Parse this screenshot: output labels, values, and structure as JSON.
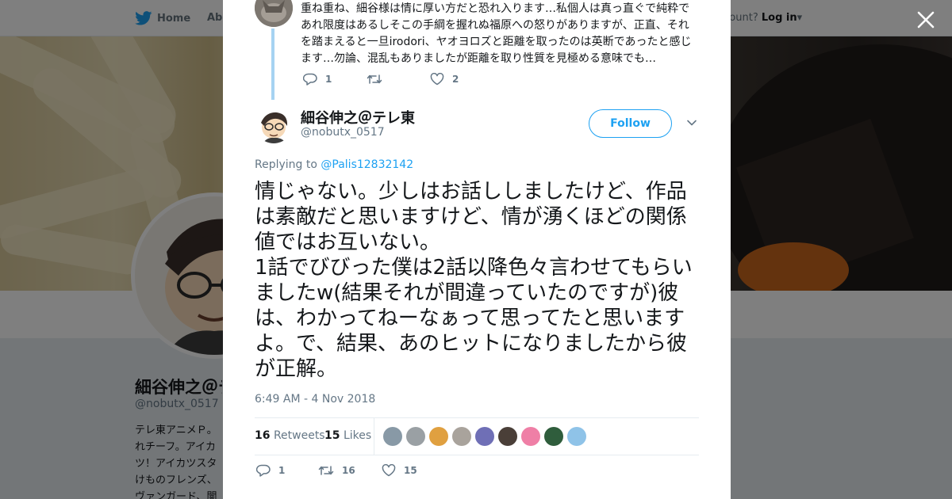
{
  "background": {
    "nav": {
      "home_label": "Home",
      "about_label": "Abo",
      "account_prompt": "ccount?",
      "login_label": "Log in"
    },
    "profile": {
      "name": "細谷伸之＠テ",
      "handle": "@nobutx_0517",
      "bio": "テレ東アニメＰ。れチーフ。アイカツ！アイカツスタけものフレンズ、ヴァンガード、闇"
    }
  },
  "modal": {
    "previous_tweet": {
      "text": "重ね重ね、細谷様は情に厚い方だと恐れ入ります…私個人は真っ直ぐで純粋であれ限度はあるしそこの手綱を握れぬ福原への怒りがありますが、正直、それを踏まえると一旦irodori、ヤオヨロズと距離を取ったのは英断であったと感じます…勿論、混乱もありましたが距離を取り性質を見極める意味でも…",
      "replies": "1",
      "retweets": "",
      "likes": "2"
    },
    "tweet": {
      "display_name": "細谷伸之＠テレ東",
      "handle": "@nobutx_0517",
      "follow_label": "Follow",
      "replying_prefix": "Replying to",
      "replying_to": "@Palis12832142",
      "text": "情じゃない。少しはお話ししましたけど、作品は素敵だと思いますけど、情が湧くほどの関係値ではお互いない。\n1話でびびった僕は2話以降色々言わせてもらいましたw(結果それが間違っていたのですが)彼は、わかってねーなぁって思ってたと思いますよ。で、結果、あのヒットになりましたから彼が正解。",
      "timestamp": "6:49 AM - 4 Nov 2018",
      "retweets_count": "16",
      "retweets_label": "Retweets",
      "likes_count": "15",
      "likes_label": "Likes",
      "action_replies": "1",
      "action_retweets": "16",
      "action_likes": "15"
    },
    "liker_avatar_colors": [
      "#8899a6",
      "#9aa0a4",
      "#e0a040",
      "#a9a39c",
      "#6f6fb6",
      "#4a3f38",
      "#ef7fa6",
      "#2f5d3c",
      "#8fc3e8"
    ]
  },
  "colors": {
    "accent": "#1da1f2",
    "thread_line": "#a6d3f2",
    "text": "#14171a",
    "muted": "#657786"
  }
}
